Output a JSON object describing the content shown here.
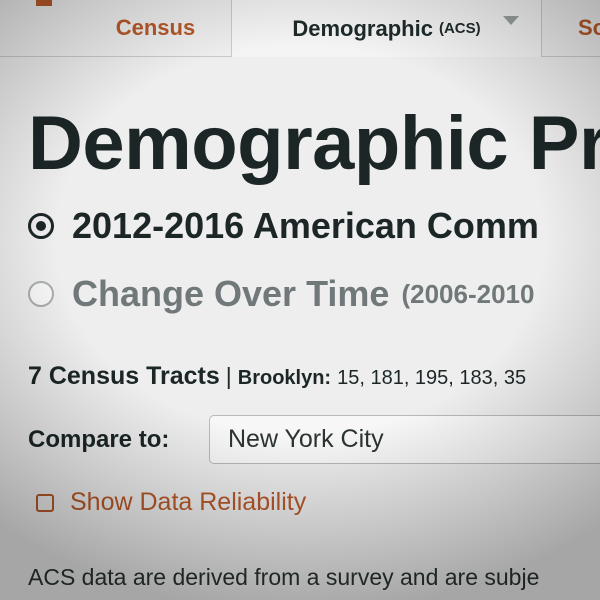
{
  "tabs": {
    "census": "Census",
    "demographic": "Demographic",
    "demographic_sub": "(ACS)",
    "social_partial": "So"
  },
  "page_title": "Demographic Pr",
  "options": {
    "acs": "2012-2016 American Comm",
    "change": "Change Over Time",
    "change_range": "(2006-2010"
  },
  "tracts": {
    "count_label": "7 Census Tracts",
    "separator": "|",
    "borough": "Brooklyn:",
    "list": "15, 181, 195, 183, 35"
  },
  "compare": {
    "label": "Compare to:",
    "selected": "New York City"
  },
  "reliability_label": "Show Data Reliability",
  "note": "ACS data are derived from a survey and are subje",
  "colors": {
    "accent": "#b6592a",
    "text": "#1c2626",
    "muted": "#70787a"
  }
}
